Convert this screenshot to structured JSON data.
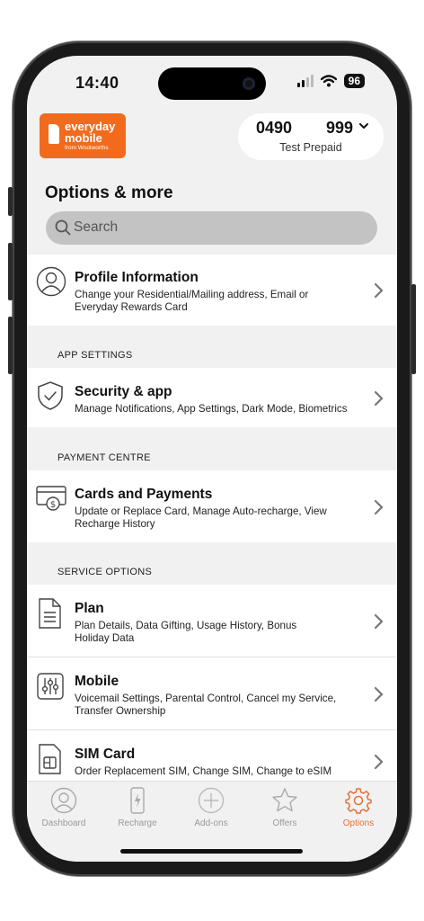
{
  "status": {
    "time": "14:40",
    "battery": "96"
  },
  "brand": {
    "line1": "everyday",
    "line2": "mobile",
    "line3": "from Woolworths"
  },
  "account": {
    "number_prefix": "0490",
    "number_suffix": "999",
    "plan": "Test Prepaid"
  },
  "page": {
    "title": "Options & more"
  },
  "search": {
    "placeholder": "Search"
  },
  "sections": {
    "app_settings": "APP SETTINGS",
    "payment_centre": "PAYMENT CENTRE",
    "service_options": "SERVICE OPTIONS"
  },
  "items": {
    "profile": {
      "title": "Profile Information",
      "desc": "Change your Residential/Mailing address, Email or Everyday Rewards Card",
      "icon": "user-circle-icon"
    },
    "security": {
      "title": "Security & app",
      "desc": "Manage Notifications, App Settings, Dark Mode, Biometrics",
      "icon": "shield-check-icon"
    },
    "cards": {
      "title": "Cards and Payments",
      "desc": "Update or Replace Card, Manage Auto-recharge, View Recharge History",
      "icon": "card-dollar-icon"
    },
    "plan": {
      "title": "Plan",
      "desc": "Plan Details, Data Gifting, Usage History, Bonus Holiday Data",
      "icon": "document-icon"
    },
    "mobile": {
      "title": "Mobile",
      "desc": "Voicemail Settings, Parental Control, Cancel my Service, Transfer Ownership",
      "icon": "sliders-icon"
    },
    "sim": {
      "title": "SIM Card",
      "desc": "Order Replacement SIM, Change SIM, Change to eSIM",
      "icon": "sim-card-icon"
    }
  },
  "tabs": [
    {
      "label": "Dashboard",
      "icon": "gauge-icon"
    },
    {
      "label": "Recharge",
      "icon": "phone-bolt-icon"
    },
    {
      "label": "Add-ons",
      "icon": "plus-circle-icon"
    },
    {
      "label": "Offers",
      "icon": "star-icon"
    },
    {
      "label": "Options",
      "icon": "gear-icon",
      "active": true
    }
  ],
  "colors": {
    "brand_orange": "#f26b1d",
    "active_tab": "#e0723b",
    "background": "#f1f1f1"
  }
}
